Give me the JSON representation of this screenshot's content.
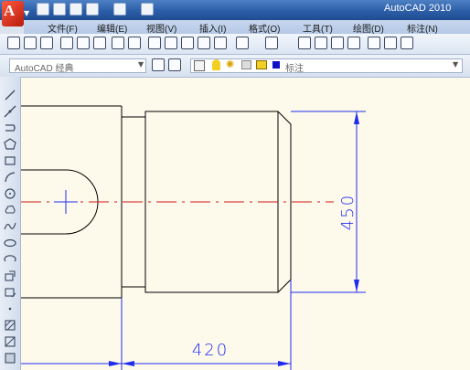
{
  "window": {
    "app_title": "AutoCAD 2010",
    "logo_letter": "A"
  },
  "menu": [
    {
      "label": "文件(F)"
    },
    {
      "label": "编辑(E)"
    },
    {
      "label": "视图(V)"
    },
    {
      "label": "插入(I)"
    },
    {
      "label": "格式(O)"
    },
    {
      "label": "工具(T)"
    },
    {
      "label": "绘图(D)"
    },
    {
      "label": "标注(N)"
    }
  ],
  "workspace": {
    "label": "AutoCAD 经典"
  },
  "layer": {
    "label": "标注",
    "color": "#1010c8"
  },
  "colors": {
    "dimension": "#1f2cf0",
    "centerline": "#d41515",
    "outline": "#000000",
    "canvas": "#fefaeb"
  },
  "drawing": {
    "dim_vertical": "450",
    "dim_horizontal": "420"
  }
}
